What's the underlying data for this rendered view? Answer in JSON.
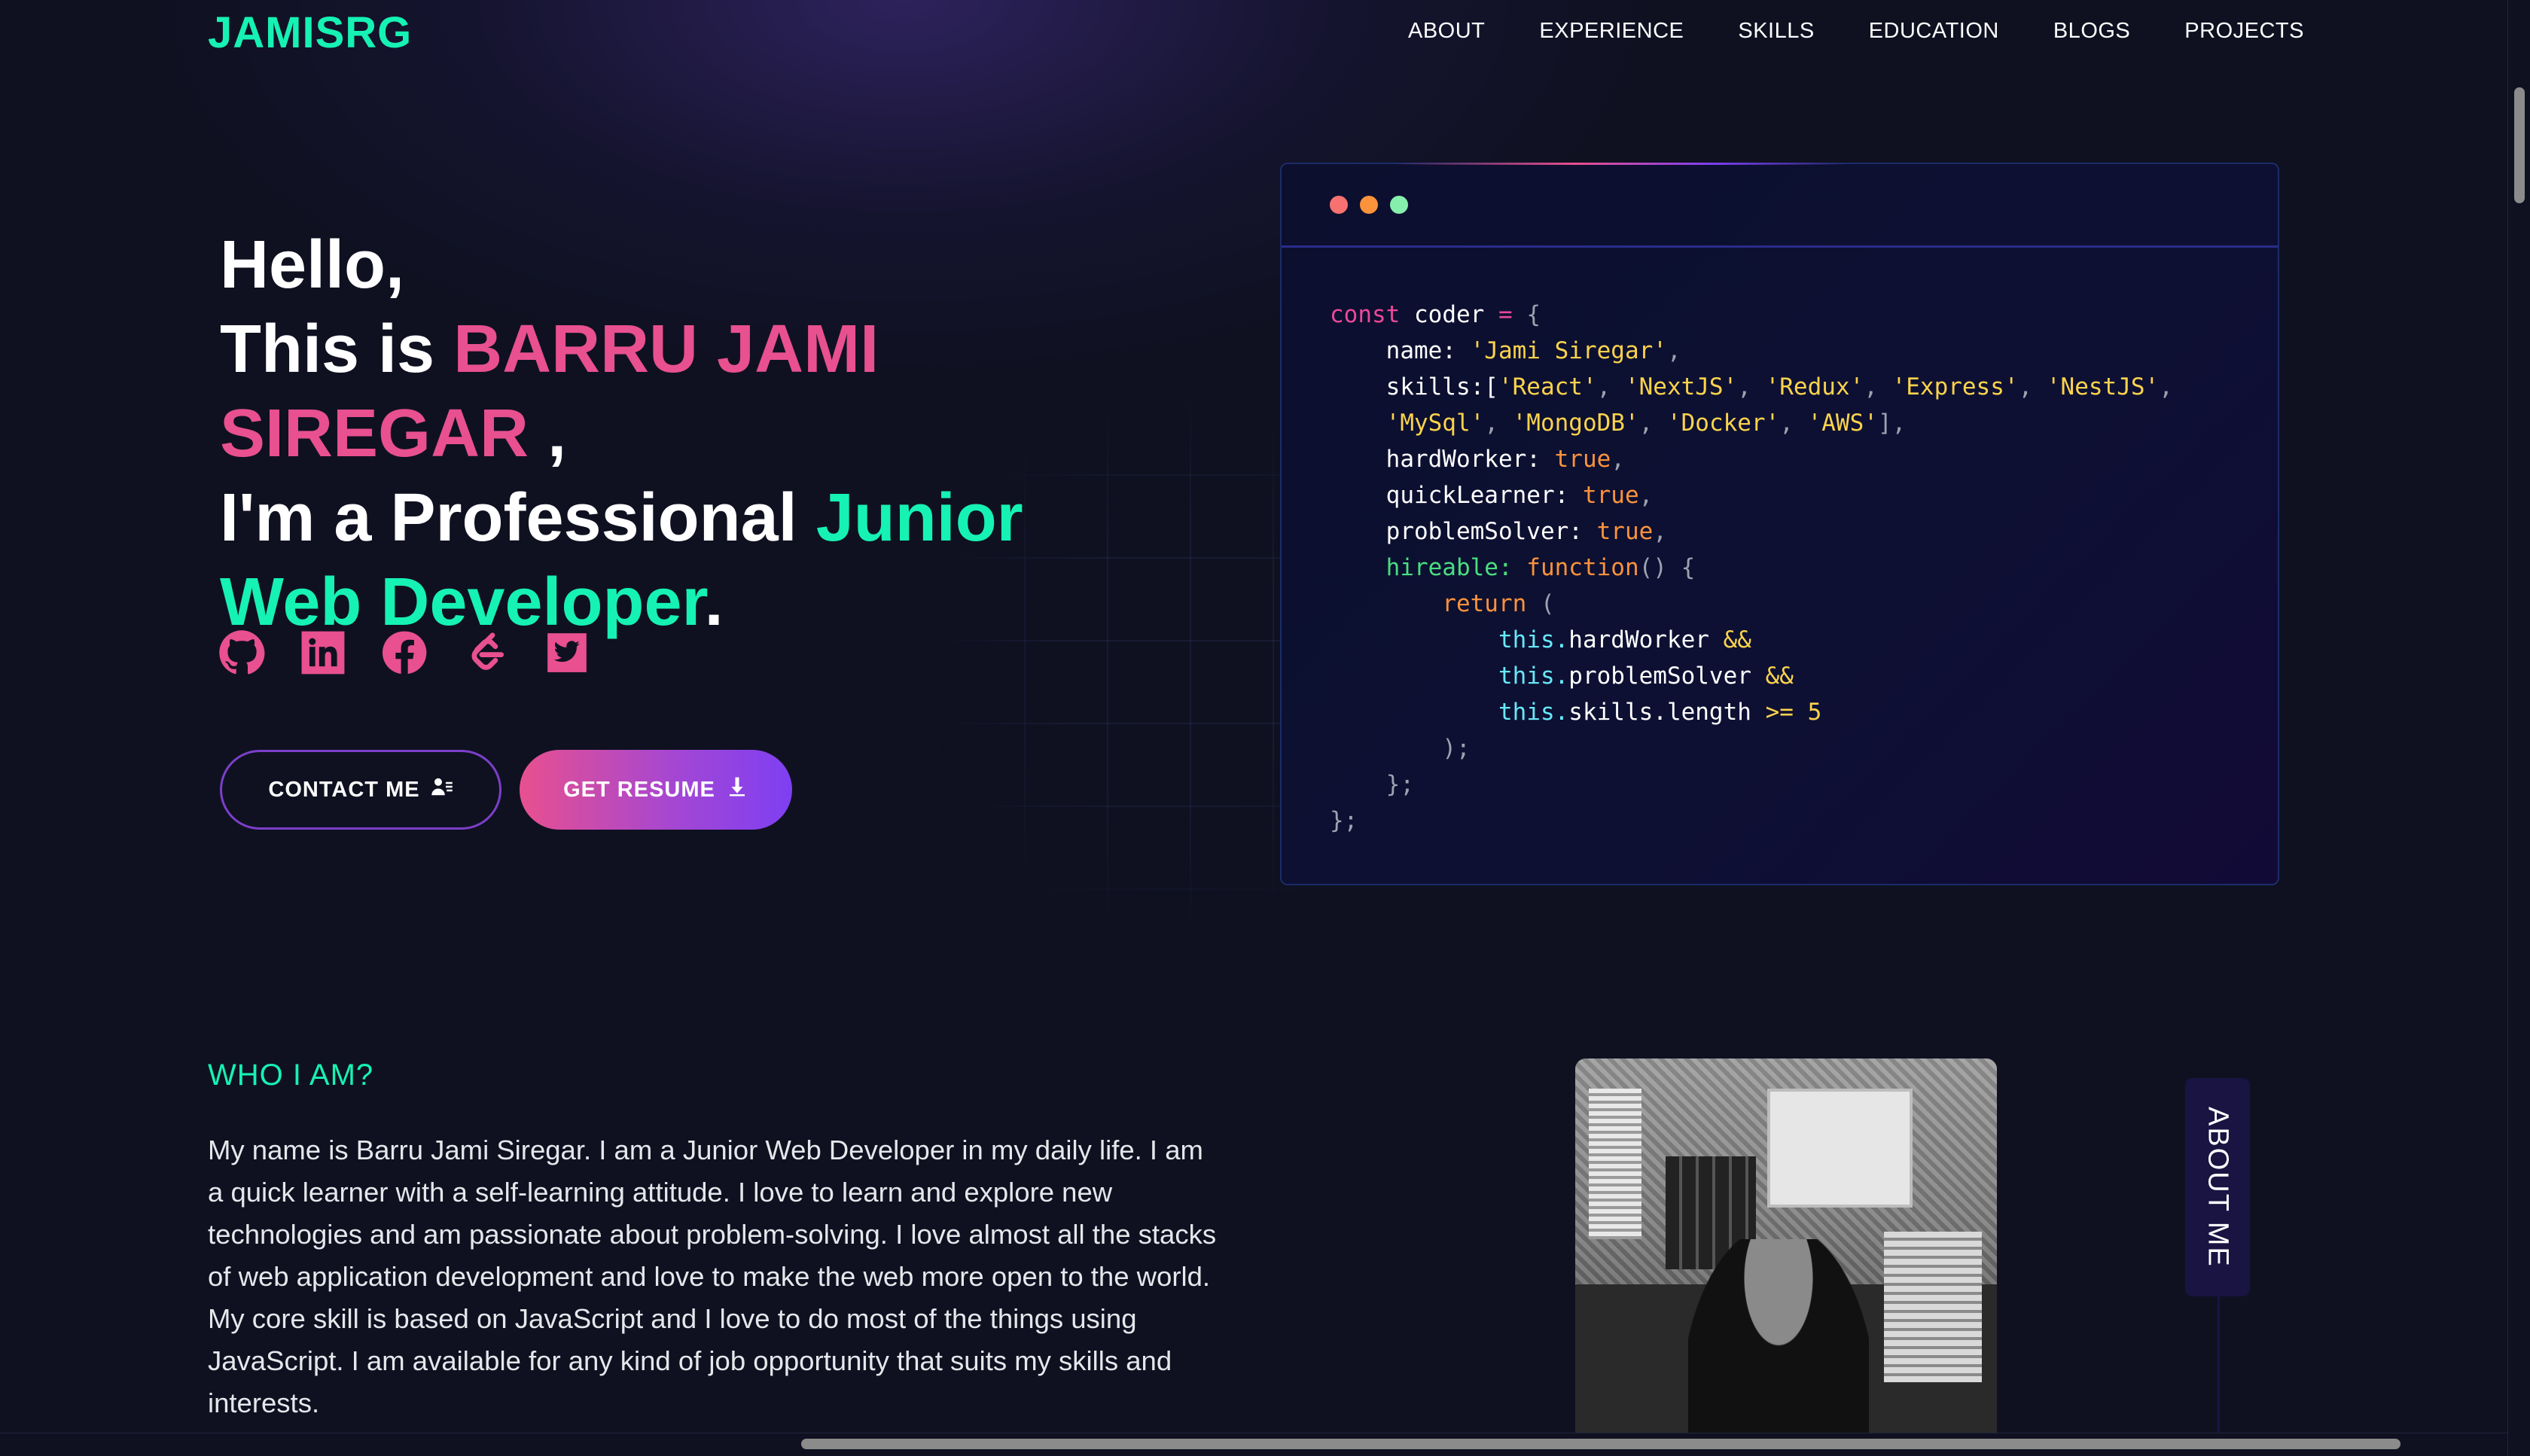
{
  "nav": {
    "logo": "JAMISRG",
    "items": [
      {
        "label": "ABOUT"
      },
      {
        "label": "EXPERIENCE"
      },
      {
        "label": "SKILLS"
      },
      {
        "label": "EDUCATION"
      },
      {
        "label": "BLOGS"
      },
      {
        "label": "PROJECTS"
      }
    ]
  },
  "hero": {
    "greeting": "Hello,",
    "this_is": "This is ",
    "name": "BARRU JAMI SIREGAR",
    "name_suffix": " ,",
    "im_a": "I'm a Professional ",
    "role": "Junior Web Developer",
    "period": ".",
    "socials": [
      {
        "icon": "github-icon"
      },
      {
        "icon": "linkedin-icon"
      },
      {
        "icon": "facebook-icon"
      },
      {
        "icon": "leetcode-icon"
      },
      {
        "icon": "twitter-icon"
      }
    ],
    "contact_label": "CONTACT ME",
    "resume_label": "GET RESUME"
  },
  "code": {
    "line1_kw": "const",
    "line1_var": " coder ",
    "line1_op": "=",
    "line1_brace": " {",
    "name_key": "name: ",
    "name_val": "'Jami Siregar'",
    "skills_key": "skills:[",
    "skills_1": "'React'",
    "skills_2": "'NextJS'",
    "skills_3": "'Redux'",
    "skills_4": "'Express'",
    "skills_5": "'NestJS'",
    "skills_6": "'MySql'",
    "skills_7": "'MongoDB'",
    "skills_8": "'Docker'",
    "skills_9": "'AWS'",
    "hard_key": "hardWorker: ",
    "quick_key": "quickLearner: ",
    "problem_key": "problemSolver: ",
    "true_val": "true",
    "hireable_key": "hireable: ",
    "function_kw": "function",
    "return_kw": "return",
    "this_kw": "this.",
    "hw_prop": "hardWorker ",
    "ps_prop": "problemSolver ",
    "sl_prop": "skills.length ",
    "and_op": "&&",
    "gte_op": ">=",
    "five": " 5"
  },
  "about": {
    "heading": "WHO I AM?",
    "text": "My name is Barru Jami Siregar. I am a Junior Web Developer in my daily life. I am a quick learner with a self-learning attitude. I love to learn and explore new technologies and am passionate about problem-solving. I love almost all the stacks of web application development and love to make the web more open to the world. My core skill is based on JavaScript and I love to do most of the things using JavaScript. I am available for any kind of job opportunity that suits my skills and interests.",
    "side_tab": "ABOUT ME"
  }
}
